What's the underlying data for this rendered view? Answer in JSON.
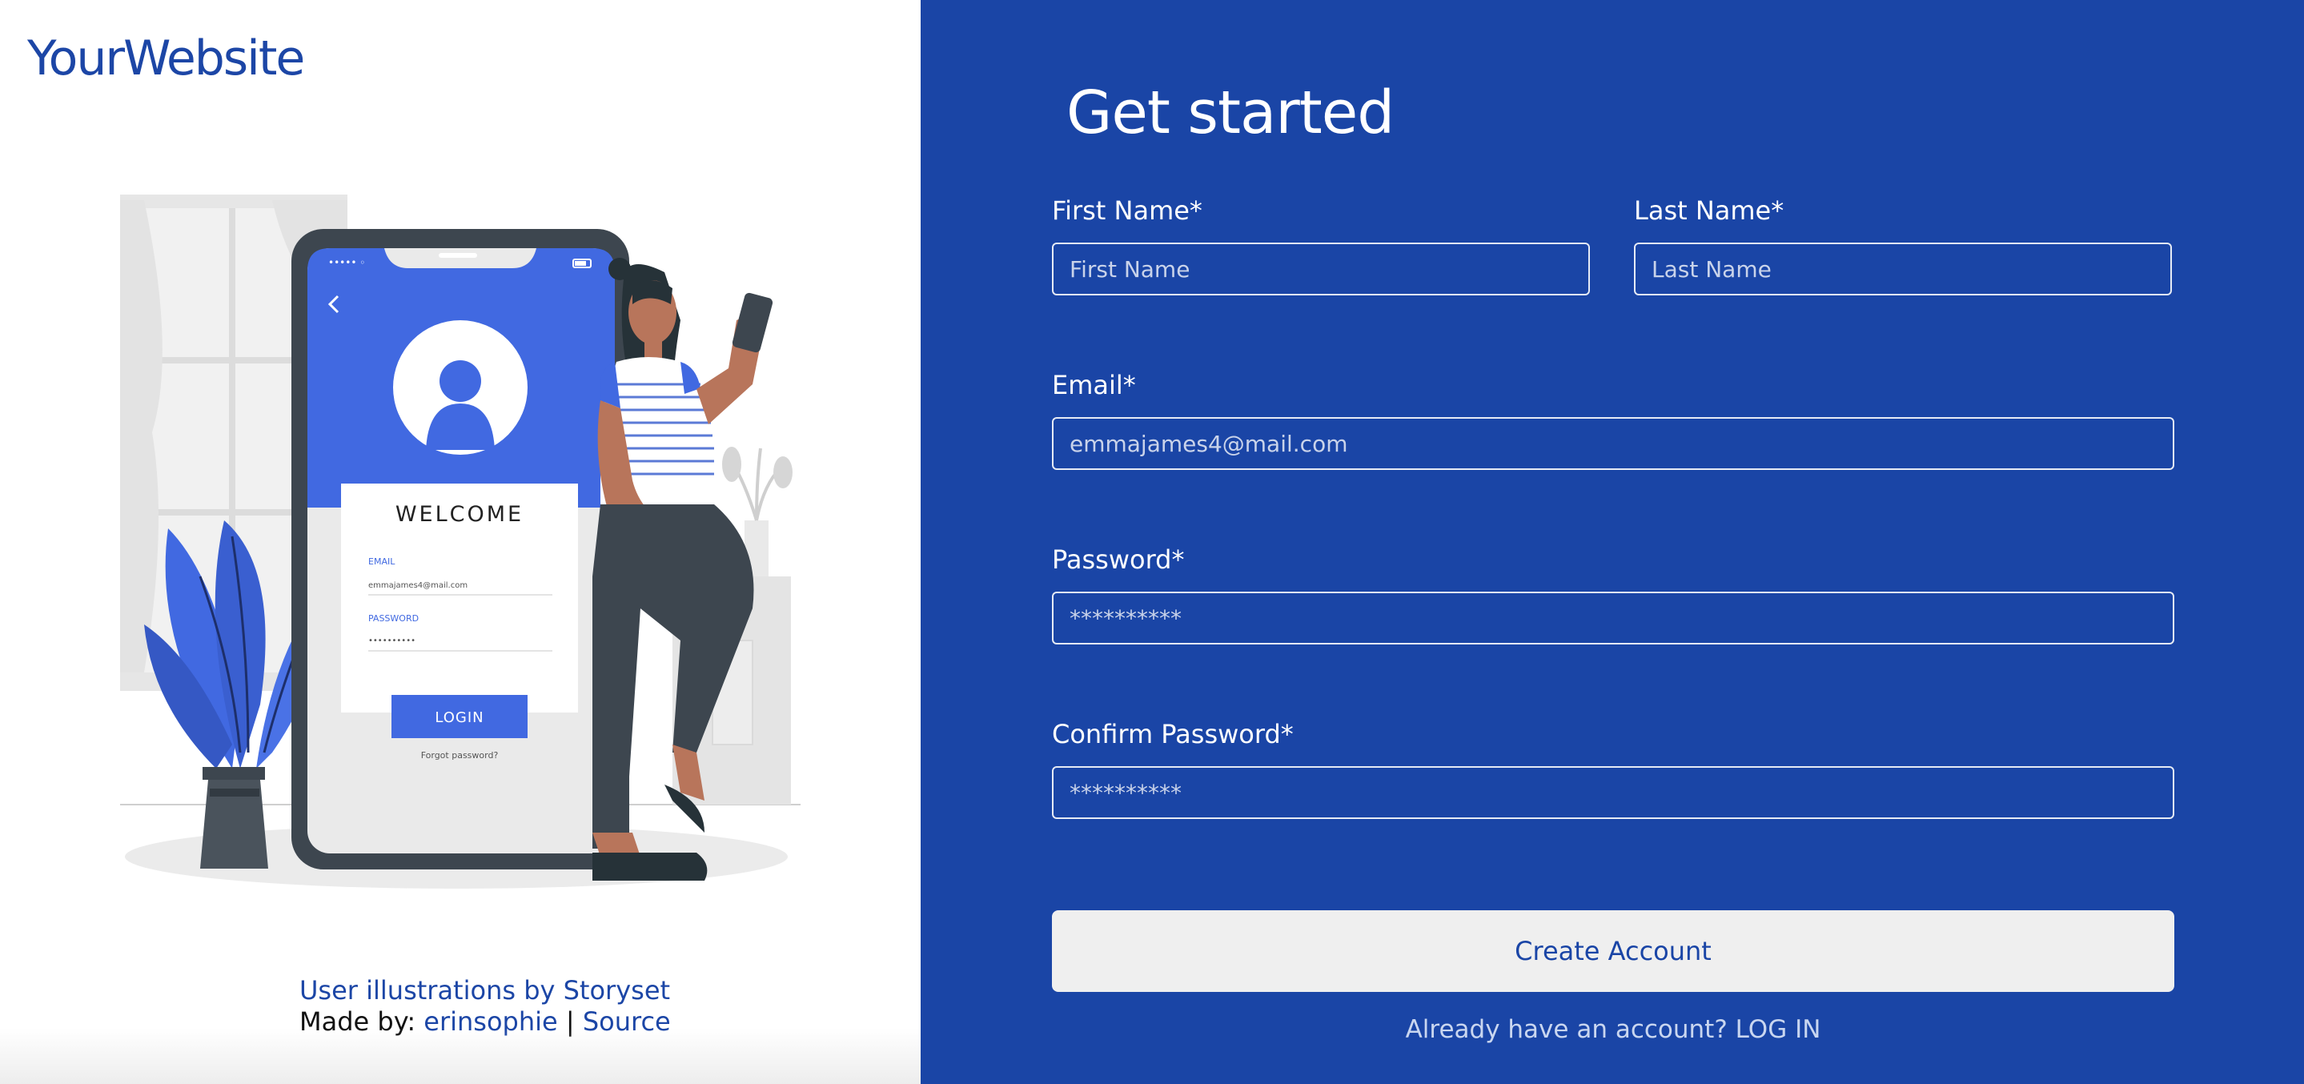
{
  "brand": {
    "name": "YourWebsite"
  },
  "illustration": {
    "welcome": "WELCOME",
    "email_label": "EMAIL",
    "email_value": "emmajames4@mail.com",
    "password_label": "PASSWORD",
    "password_value": "••••••••••",
    "login_button": "LOGIN",
    "forgot": "Forgot password?"
  },
  "credits": {
    "line1": "User illustrations by Storyset",
    "made_by": "Made by: ",
    "author": "erinsophie",
    "separator": " | ",
    "source": "Source"
  },
  "form": {
    "title": "Get started",
    "first_name": {
      "label": "First Name*",
      "placeholder": "First Name"
    },
    "last_name": {
      "label": "Last Name*",
      "placeholder": "Last Name"
    },
    "email": {
      "label": "Email*",
      "placeholder": "emmajames4@mail.com"
    },
    "password": {
      "label": "Password*",
      "placeholder": "**********"
    },
    "confirm_password": {
      "label": "Confirm Password*",
      "placeholder": "**********"
    },
    "submit": "Create Account",
    "login_prompt": "Already have an account? ",
    "login_link": "LOG IN"
  },
  "colors": {
    "brand_blue": "#1a45a6",
    "accent_blue": "#4169e1",
    "button_bg": "#efefef"
  }
}
